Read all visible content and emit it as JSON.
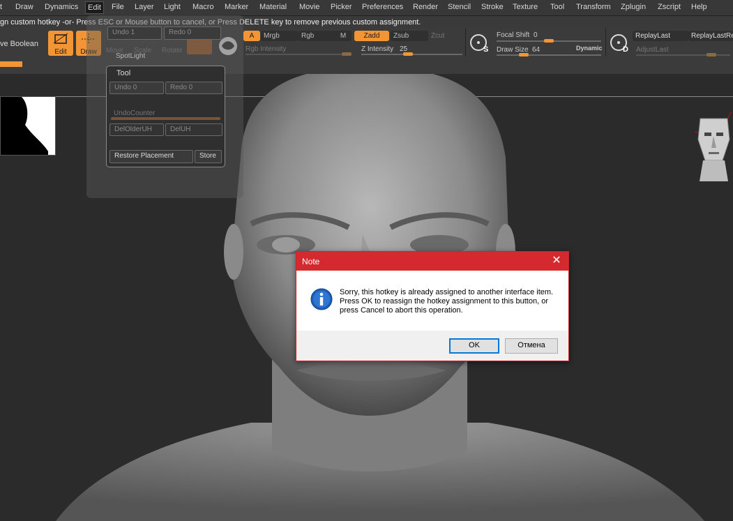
{
  "menu": {
    "items": [
      "t",
      "Draw",
      "Dynamics",
      "Edit",
      "File",
      "Layer",
      "Light",
      "Macro",
      "Marker",
      "Material",
      "Movie",
      "Picker",
      "Preferences",
      "Render",
      "Stencil",
      "Stroke",
      "Texture",
      "Tool",
      "Transform",
      "Zplugin",
      "Zscript",
      "Help"
    ],
    "active": "Edit"
  },
  "info_line": "gn custom hotkey -or- Press ESC or Mouse button to cancel, or Press DELETE key to remove previous custom assignment.",
  "toolbar": {
    "live_boolean": "ve Boolean",
    "edit": "Edit",
    "draw": "Draw",
    "move": "Move",
    "scale": "Scale",
    "rotate": "Rotate",
    "spotlight": "SpotLight",
    "a": "A",
    "mrgb": "Mrgb",
    "rgb": "Rgb",
    "m": "M",
    "zadd": "Zadd",
    "zsub": "Zsub",
    "zcut": "Zcut",
    "rgb_intensity": "Rgb Intensity",
    "z_intensity_label": "Z Intensity",
    "z_intensity_value": "25",
    "focal_shift_label": "Focal Shift",
    "focal_shift_value": "0",
    "draw_size_label": "Draw Size",
    "draw_size_value": "64",
    "dynamic": "Dynamic",
    "replay_last": "ReplayLast",
    "replay_last_rel": "ReplayLastRe",
    "adjust_last": "AdjustLast",
    "s_label": "S",
    "d_label": "D"
  },
  "edit_panel": {
    "undo_top": "Undo 1",
    "redo_top": "Redo 0",
    "tool_title": "Tool",
    "undo": "Undo 0",
    "redo": "Redo 0",
    "undo_counter": "UndoCounter",
    "del_older_uh": "DelOlderUH",
    "del_uh": "DelUH",
    "restore_placement": "Restore Placement",
    "store": "Store"
  },
  "dialog": {
    "title": "Note",
    "message": "Sorry, this hotkey is already assigned to another interface item. Press OK to reassign the hotkey assignment to this button, or press Cancel to abort this operation.",
    "ok": "OK",
    "cancel": "Отмена",
    "close_symbol": "✕"
  },
  "colors": {
    "accent": "#f29534",
    "dialog_title": "#d42a2f",
    "background": "#2a2a2a"
  },
  "icons": [
    "info-icon",
    "close-icon",
    "sculpt-brush-s-icon",
    "sculpt-brush-d-icon",
    "material-sphere-icon"
  ]
}
